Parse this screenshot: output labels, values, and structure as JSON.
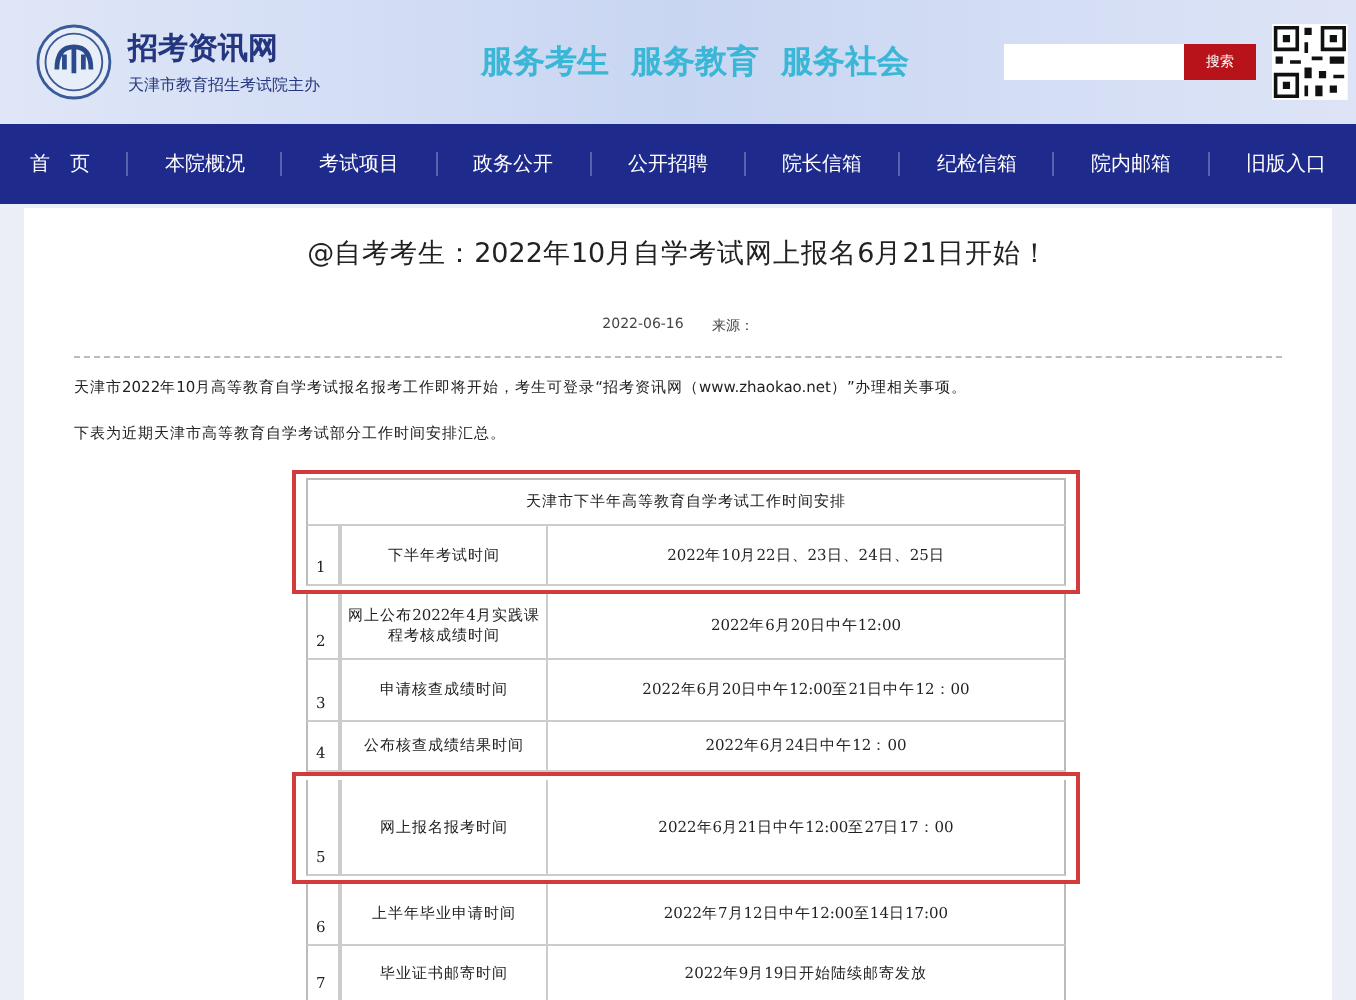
{
  "header": {
    "site_name": "招考资讯网",
    "site_subtitle": "天津市教育招生考试院主办",
    "slogan": "服务考生  服务教育  服务社会",
    "search_button": "搜索"
  },
  "nav": [
    {
      "label": "首　页"
    },
    {
      "label": "本院概况"
    },
    {
      "label": "考试项目"
    },
    {
      "label": "政务公开"
    },
    {
      "label": "公开招聘"
    },
    {
      "label": "院长信箱"
    },
    {
      "label": "纪检信箱"
    },
    {
      "label": "院内邮箱"
    },
    {
      "label": "旧版入口"
    }
  ],
  "article": {
    "title": "@自考考生：2022年10月自学考试网上报名6月21日开始！",
    "date": "2022-06-16",
    "source_label": "来源：",
    "paragraphs": [
      "天津市2022年10月高等教育自学考试报名报考工作即将开始，考生可登录“招考资讯网（www.zhaokao.net）”办理相关事项。",
      "下表为近期天津市高等教育自学考试部分工作时间安排汇总。"
    ]
  },
  "table": {
    "title": "天津市下半年高等教育自学考试工作时间安排",
    "title_highlighted": true,
    "rows": [
      {
        "no": "1",
        "item": "下半年考试时间",
        "time": "2022年10月22日、23日、24日、25日",
        "highlighted": true
      },
      {
        "no": "2",
        "item": "网上公布2022年4月实践课程考核成绩时间",
        "time": "2022年6月20日中午12:00",
        "highlighted": false
      },
      {
        "no": "3",
        "item": "申请核查成绩时间",
        "time": "2022年6月20日中午12:00至21日中午12：00",
        "highlighted": false
      },
      {
        "no": "4",
        "item": "公布核查成绩结果时间",
        "time": "2022年6月24日中午12：00",
        "highlighted": false
      },
      {
        "no": "5",
        "item": "网上报名报考时间",
        "time": "2022年6月21日中午12:00至27日17：00",
        "highlighted": true
      },
      {
        "no": "6",
        "item": "上半年毕业申请时间",
        "time": "2022年7月12日中午12:00至14日17:00",
        "highlighted": false
      },
      {
        "no": "7",
        "item": "毕业证书邮寄时间",
        "time": "2022年9月19日开始陆续邮寄发放",
        "highlighted": false
      }
    ]
  }
}
